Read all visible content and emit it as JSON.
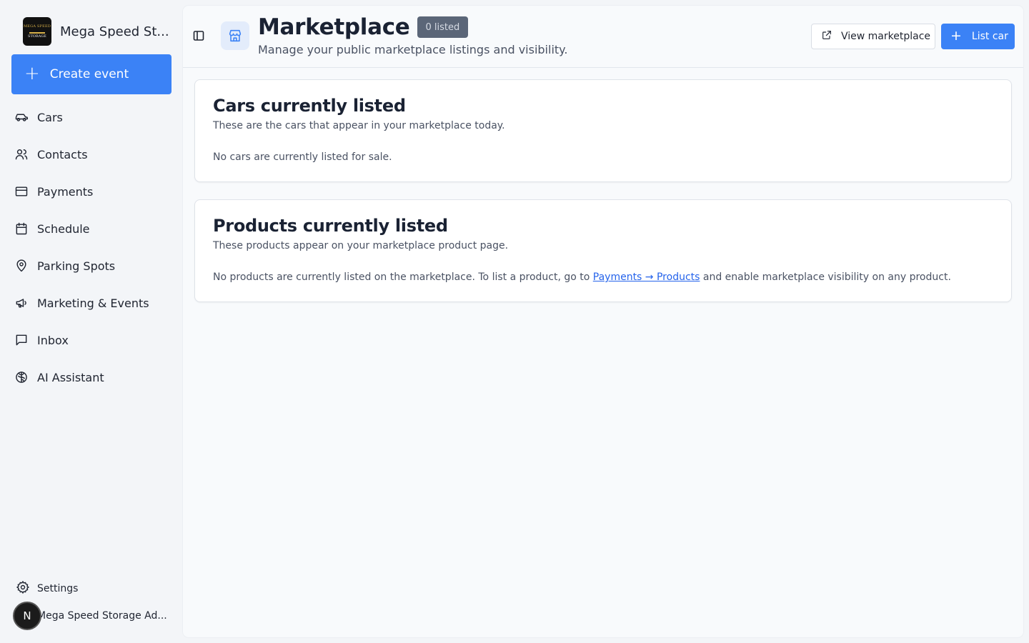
{
  "sidebar": {
    "brand_name": "Mega Speed St...",
    "logo_text": [
      "MEGA SPEED",
      "STORAGE"
    ],
    "create_label": "Create event",
    "items": [
      {
        "label": "Cars",
        "icon": "car-icon"
      },
      {
        "label": "Contacts",
        "icon": "users-icon"
      },
      {
        "label": "Payments",
        "icon": "credit-card-icon"
      },
      {
        "label": "Schedule",
        "icon": "calendar-icon"
      },
      {
        "label": "Parking Spots",
        "icon": "map-pin-icon"
      },
      {
        "label": "Marketing & Events",
        "icon": "megaphone-icon"
      },
      {
        "label": "Inbox",
        "icon": "message-square-icon"
      },
      {
        "label": "AI Assistant",
        "icon": "brain-icon"
      }
    ],
    "settings_label": "Settings",
    "account": {
      "initial": "N",
      "name": "Mega Speed Storage Ad..."
    }
  },
  "header": {
    "title": "Marketplace",
    "badge": "0 listed",
    "subtitle": "Manage your public marketplace listings and visibility.",
    "view_marketplace_label": "View marketplace",
    "list_car_label": "List car"
  },
  "cards": {
    "cars": {
      "title": "Cars currently listed",
      "description": "These are the cars that appear in your marketplace today.",
      "empty": "No cars are currently listed for sale."
    },
    "products": {
      "title": "Products currently listed",
      "description": "These products appear on your marketplace product page.",
      "empty_before": "No products are currently listed on the marketplace. To list a product, go to ",
      "link": "Payments → Products",
      "empty_after": " and enable marketplace visibility on any product."
    }
  },
  "colors": {
    "accent": "#3b82f6",
    "badge_bg": "#5b6678",
    "link": "#2563eb"
  }
}
